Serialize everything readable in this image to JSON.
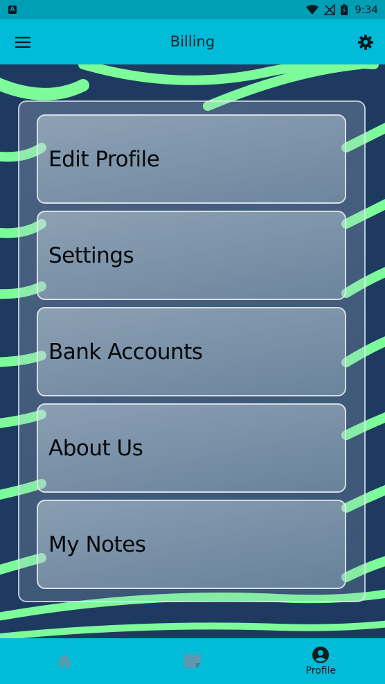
{
  "status_bar": {
    "time": "9:34",
    "badge": "A",
    "icons": [
      "wifi-icon",
      "no-signal-icon",
      "battery-icon"
    ]
  },
  "app_bar": {
    "title": "Billing",
    "left_icon": "hamburger-menu-icon",
    "right_icon": "gear-icon"
  },
  "menu": {
    "items": [
      {
        "label": "Edit Profile"
      },
      {
        "label": "Settings"
      },
      {
        "label": "Bank Accounts"
      },
      {
        "label": "About Us"
      },
      {
        "label": "My Notes"
      }
    ]
  },
  "bottom_nav": {
    "items": [
      {
        "icon": "home-icon",
        "label": ""
      },
      {
        "icon": "note-icon",
        "label": ""
      },
      {
        "icon": "profile-icon",
        "label": "Profile",
        "active": true
      }
    ]
  },
  "colors": {
    "status_bar": "#019fb6",
    "app_bar": "#00bcd8",
    "background": "#1f3a60",
    "accent_stripe": "#7dfa9a",
    "inactive_icon": "#5c98b0",
    "active_icon": "#0d1b22"
  }
}
